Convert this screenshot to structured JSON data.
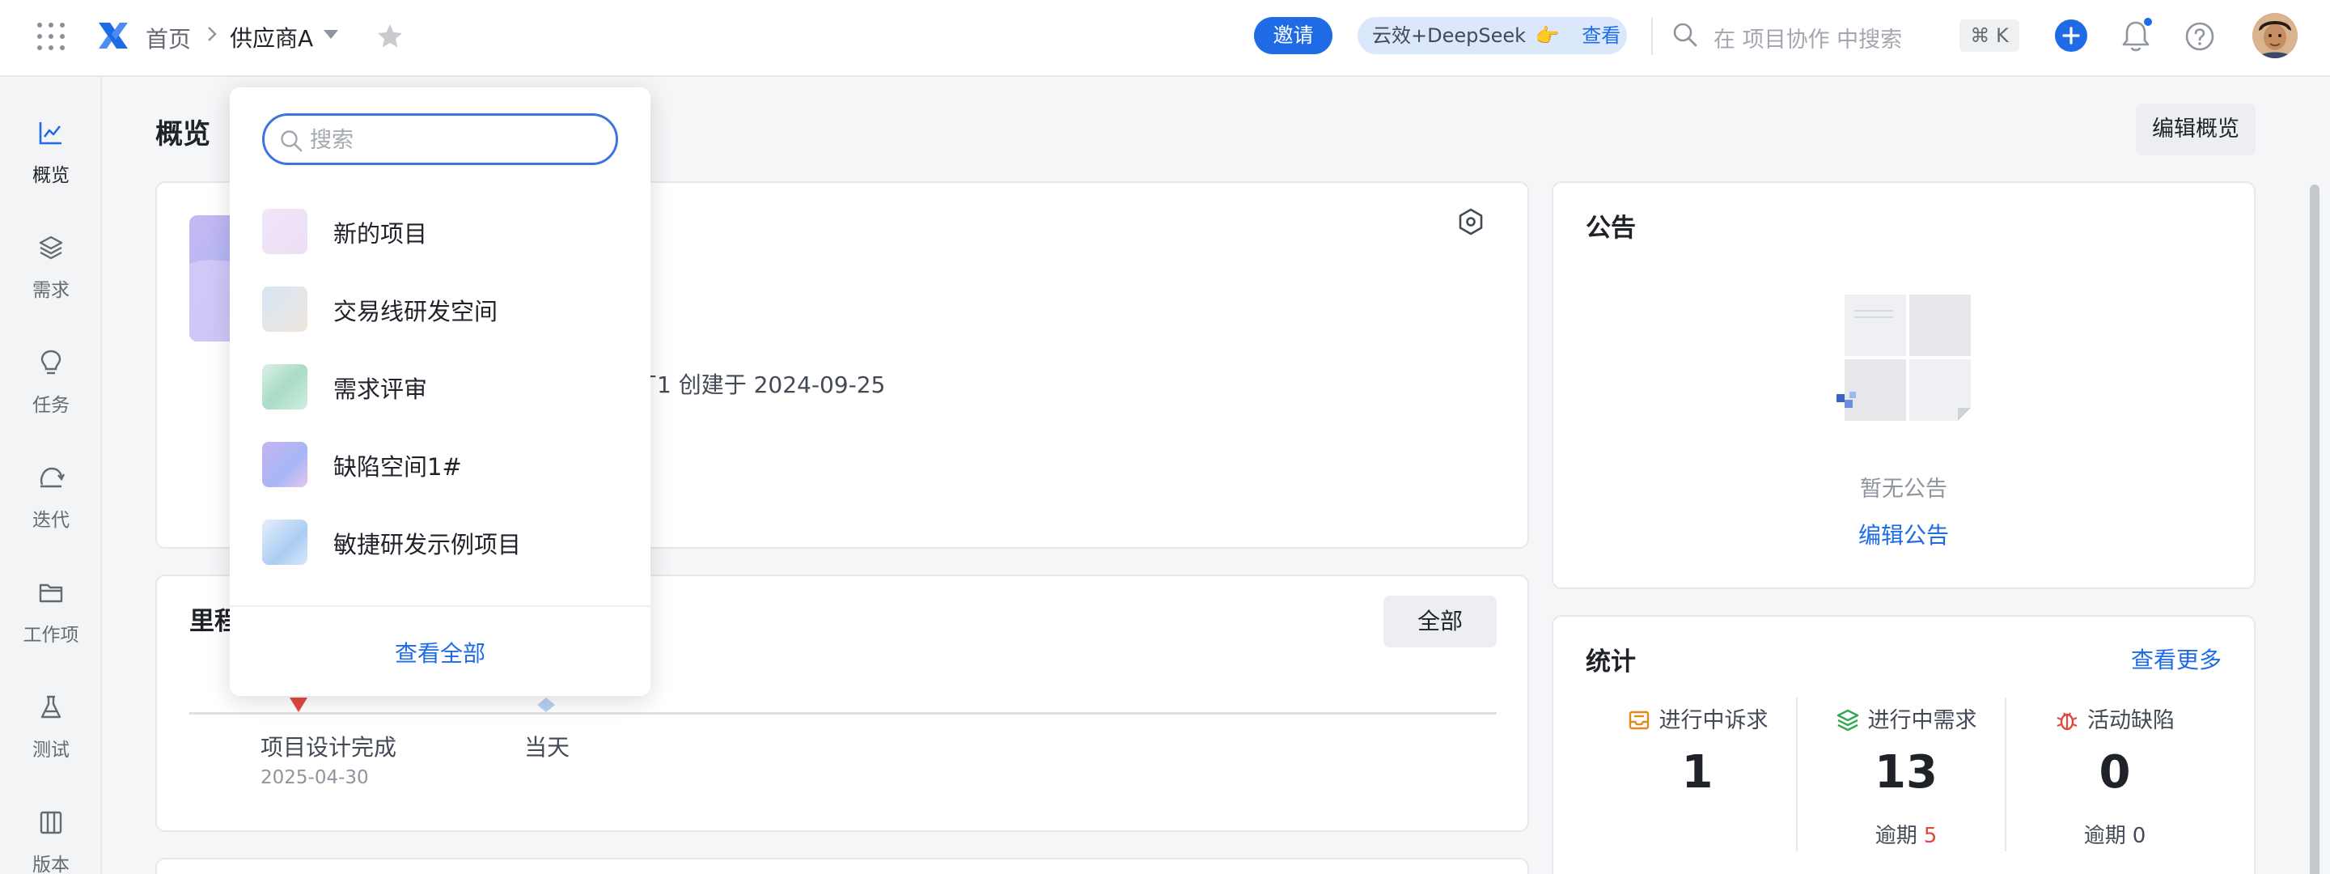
{
  "header": {
    "breadcrumb_home": "首页",
    "breadcrumb_current": "供应商A",
    "invite_label": "邀请",
    "ai_label": "云效+DeepSeek",
    "ai_hand": "👉",
    "ai_view": "查看",
    "search_placeholder": "在 项目协作 中搜索",
    "shortcut": "⌘ K",
    "colors": {
      "accent": "#1f6be6",
      "ai_pill_bg": "#dbe8fb"
    }
  },
  "sidebar": {
    "items": [
      {
        "label": "概览",
        "icon": "chart-line-icon",
        "active": true
      },
      {
        "label": "需求",
        "icon": "layers-icon"
      },
      {
        "label": "任务",
        "icon": "lightbulb-icon"
      },
      {
        "label": "迭代",
        "icon": "cycle-icon"
      },
      {
        "label": "工作项",
        "icon": "folder-icon"
      },
      {
        "label": "测试",
        "icon": "flask-icon"
      },
      {
        "label": "版本",
        "icon": "book-icon"
      }
    ]
  },
  "main": {
    "title": "概览",
    "edit_overview": "编辑概览",
    "project_meta": "丁1  创建于 2024-09-25",
    "milestone": {
      "title": "里程",
      "all_label": "全部",
      "items": [
        {
          "name": "项目设计完成",
          "date": "2025-04-30",
          "color": "#e0483e"
        },
        {
          "name": "当天",
          "date": "",
          "color": "#b8d1f0"
        }
      ]
    },
    "notice": {
      "title": "公告",
      "empty_text": "暂无公告",
      "edit_link": "编辑公告"
    },
    "stats": {
      "title": "统计",
      "more_link": "查看更多",
      "overdue_label": "逾期",
      "items": [
        {
          "label": "进行中诉求",
          "icon": "inbox-icon",
          "value": "1",
          "overdue": "",
          "icon_color": "#e08a1e"
        },
        {
          "label": "进行中需求",
          "icon": "layers-icon",
          "value": "13",
          "overdue": "5",
          "icon_color": "#34a853"
        },
        {
          "label": "活动缺陷",
          "icon": "bug-icon",
          "value": "0",
          "overdue": "0",
          "icon_color": "#e0483e"
        }
      ]
    }
  },
  "dropdown": {
    "search_placeholder": "搜索",
    "items": [
      {
        "name": "新的项目"
      },
      {
        "name": "交易线研发空间"
      },
      {
        "name": "需求评审"
      },
      {
        "name": "缺陷空间1#"
      },
      {
        "name": "敏捷研发示例项目"
      }
    ],
    "view_all": "查看全部"
  }
}
